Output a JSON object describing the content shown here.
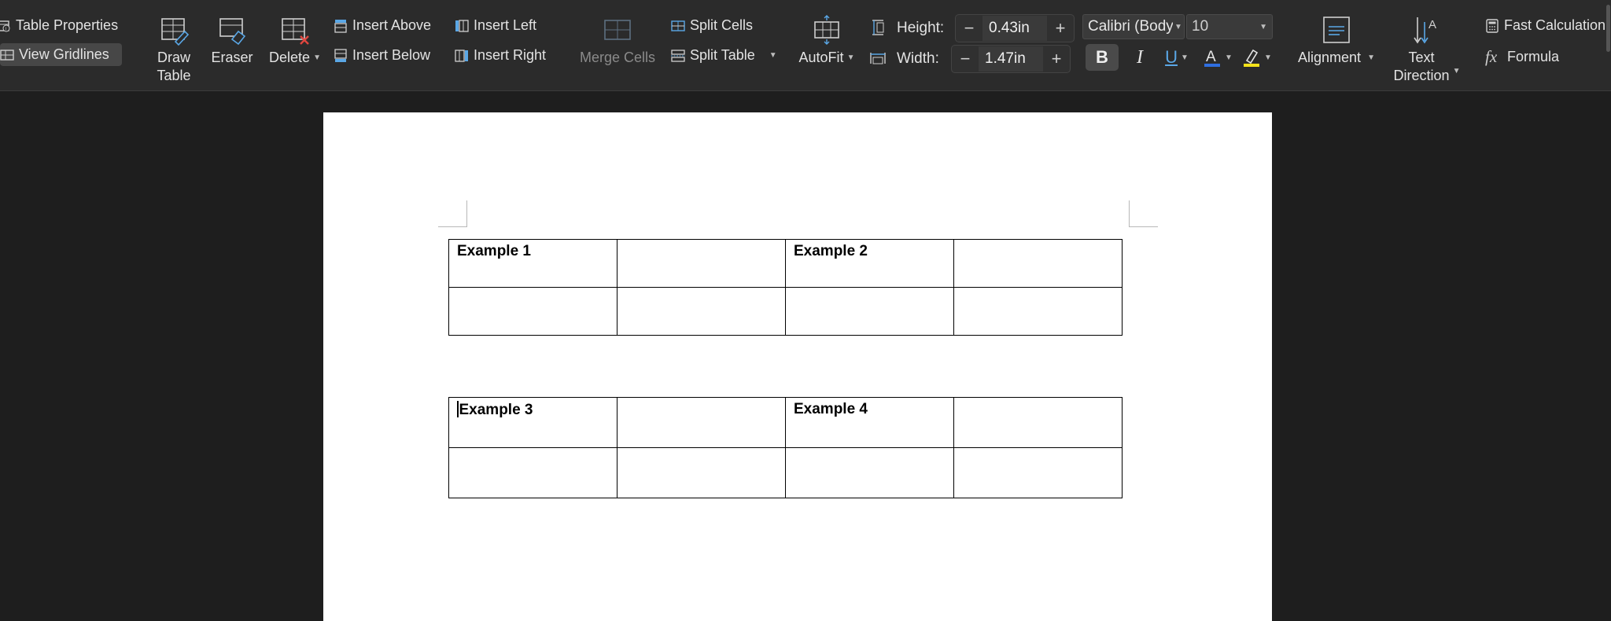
{
  "toolbar": {
    "table_properties": "Table Properties",
    "view_gridlines": "View Gridlines",
    "draw_table": "Draw\nTable",
    "eraser": "Eraser",
    "delete": "Delete",
    "insert_above": "Insert Above",
    "insert_below": "Insert Below",
    "insert_left": "Insert Left",
    "insert_right": "Insert Right",
    "merge_cells": "Merge Cells",
    "split_cells": "Split Cells",
    "split_table": "Split Table",
    "autofit": "AutoFit",
    "height_label": "Height:",
    "height_value": "0.43in",
    "width_label": "Width:",
    "width_value": "1.47in",
    "font_name": "Calibri (Body)",
    "font_size": "10",
    "bold": "B",
    "italic": "I",
    "underline": "U",
    "alignment": "Alignment",
    "text_direction": "Text\nDirection",
    "fast_calculation": "Fast Calculation",
    "formula": "Formula",
    "fx_symbol": "fx"
  },
  "colors": {
    "accent_icon": "#5aa7e6",
    "font_color_bar": "#2f6ee0",
    "highlight_bar": "#f4e21a",
    "delete_x": "#e0463f"
  },
  "document": {
    "table1": [
      [
        "Example 1",
        "",
        "Example 2",
        ""
      ],
      [
        "",
        "",
        "",
        ""
      ]
    ],
    "table2": [
      [
        "Example 3",
        "",
        "Example 4",
        ""
      ],
      [
        "",
        "",
        "",
        ""
      ]
    ]
  }
}
